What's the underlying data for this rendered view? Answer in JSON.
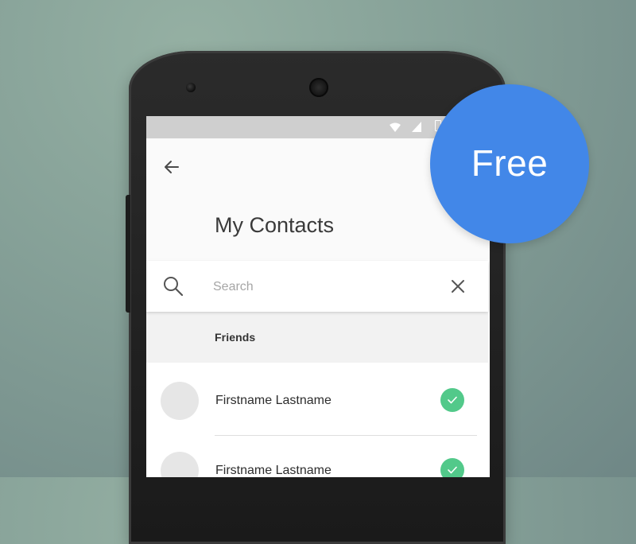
{
  "header": {
    "title": "My Contacts",
    "back_icon": "arrow-left-icon"
  },
  "search": {
    "placeholder": "Search",
    "value": "",
    "search_icon": "search-icon",
    "clear_icon": "close-icon"
  },
  "section": {
    "label": "Friends"
  },
  "contacts": [
    {
      "name": "Firstname Lastname",
      "selected": true
    },
    {
      "name": "Firstname Lastname",
      "selected": true
    }
  ],
  "badge": {
    "label": "Free",
    "color": "#4287e8"
  },
  "colors": {
    "check": "#52c98a",
    "status_bar": "#cfcfcf",
    "background": "#86a198"
  }
}
